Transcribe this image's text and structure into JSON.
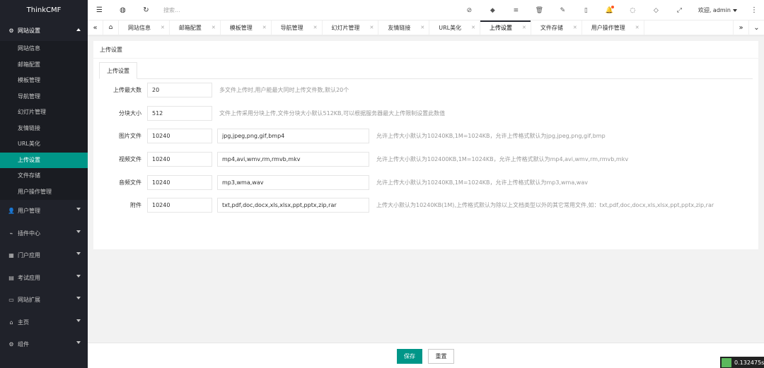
{
  "app": {
    "title": "ThinkCMF"
  },
  "sidebar": {
    "groups": [
      {
        "label": "网站设置",
        "icon": "gears-icon",
        "open": true,
        "items": [
          "网站信息",
          "邮箱配置",
          "模板管理",
          "导航管理",
          "幻灯片管理",
          "友情链接",
          "URL美化",
          "上传设置",
          "文件存储",
          "用户操作管理"
        ],
        "active": "上传设置"
      },
      {
        "label": "用户管理",
        "icon": "user-icon"
      },
      {
        "label": "插件中心",
        "icon": "plug-icon"
      },
      {
        "label": "门户应用",
        "icon": "grid-icon"
      },
      {
        "label": "考试应用",
        "icon": "file-icon"
      },
      {
        "label": "网站扩展",
        "icon": "desktop-icon"
      },
      {
        "label": "主页",
        "icon": "home-icon"
      },
      {
        "label": "组件",
        "icon": "gear-icon"
      }
    ]
  },
  "header": {
    "search_placeholder": "搜索...",
    "welcome": "欢迎, admin"
  },
  "tabs": {
    "items": [
      "网站信息",
      "邮箱配置",
      "模板管理",
      "导航管理",
      "幻灯片管理",
      "友情链接",
      "URL美化",
      "上传设置",
      "文件存储",
      "用户操作管理"
    ],
    "active": "上传设置"
  },
  "panel": {
    "title": "上传设置",
    "inner_tab": "上传设置",
    "rows": [
      {
        "label": "上传最大数",
        "value": "20",
        "hint": "多文件上传时,用户能最大同时上传文件数,默认20个"
      },
      {
        "label": "分块大小",
        "value": "512",
        "hint": "文件上传采用分块上传,文件分块大小默认512KB,可以根据服务器最大上传限制设置此数值"
      },
      {
        "label": "图片文件",
        "value": "10240",
        "ext": "jpg,jpeg,png,gif,bmp4",
        "hint": "允许上传大小默认为10240KB,1M=1024KB，允许上传格式默认为jpg,jpeg,png,gif,bmp"
      },
      {
        "label": "视频文件",
        "value": "10240",
        "ext": "mp4,avi,wmv,rm,rmvb,mkv",
        "hint": "允许上传大小默认为102400KB,1M=1024KB，允许上传格式默认为mp4,avi,wmv,rm,rmvb,mkv"
      },
      {
        "label": "音频文件",
        "value": "10240",
        "ext": "mp3,wma,wav",
        "hint": "允许上传大小默认为10240KB,1M=1024KB，允许上传格式默认为mp3,wma,wav"
      },
      {
        "label": "附件",
        "value": "10240",
        "ext": "txt,pdf,doc,docx,xls,xlsx,ppt,pptx,zip,rar",
        "hint": "上传大小默认为10240KB(1M),上传格式默认为除以上文档类型以外的其它常用文件,如：txt,pdf,doc,docx,xls,xlsx,ppt,pptx,zip,rar"
      }
    ]
  },
  "footer": {
    "save": "保存",
    "reset": "重置",
    "timer": "0.132475s"
  }
}
